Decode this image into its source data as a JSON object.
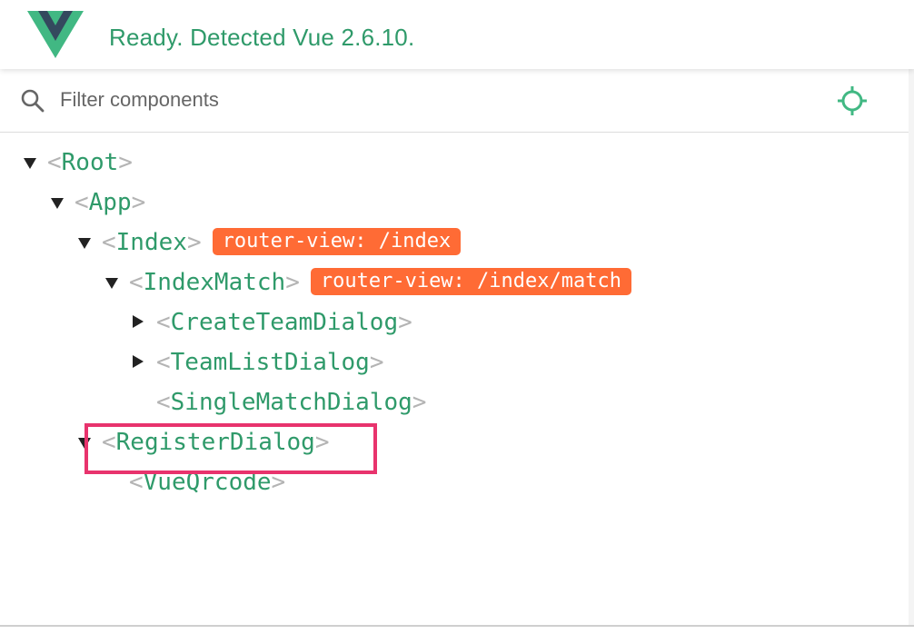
{
  "header": {
    "status": "Ready. Detected Vue 2.6.10.",
    "logo_icon": "vue-logo-icon",
    "brand_colors": {
      "green": "#41b883",
      "dark": "#34495e",
      "text": "#2f9a6a"
    }
  },
  "filter": {
    "placeholder": "Filter components",
    "value": "",
    "search_icon": "search-icon",
    "select_icon": "crosshair-icon"
  },
  "tree": {
    "open_bracket": "<",
    "close_bracket": ">",
    "nodes": [
      {
        "name": "Root",
        "expanded": true,
        "has_children": true
      },
      {
        "name": "App",
        "expanded": true,
        "has_children": true
      },
      {
        "name": "Index",
        "expanded": true,
        "has_children": true,
        "badge": "router-view: /index"
      },
      {
        "name": "IndexMatch",
        "expanded": true,
        "has_children": true,
        "badge": "router-view: /index/match"
      },
      {
        "name": "CreateTeamDialog",
        "expanded": false,
        "has_children": true
      },
      {
        "name": "TeamListDialog",
        "expanded": false,
        "has_children": true
      },
      {
        "name": "SingleMatchDialog",
        "expanded": false,
        "has_children": false
      },
      {
        "name": "RegisterDialog",
        "expanded": true,
        "has_children": true,
        "highlighted": true
      },
      {
        "name": "VueQrcode",
        "expanded": false,
        "has_children": false
      }
    ],
    "badge_color": "#ff6b35",
    "highlight_color": "#e8336d"
  }
}
